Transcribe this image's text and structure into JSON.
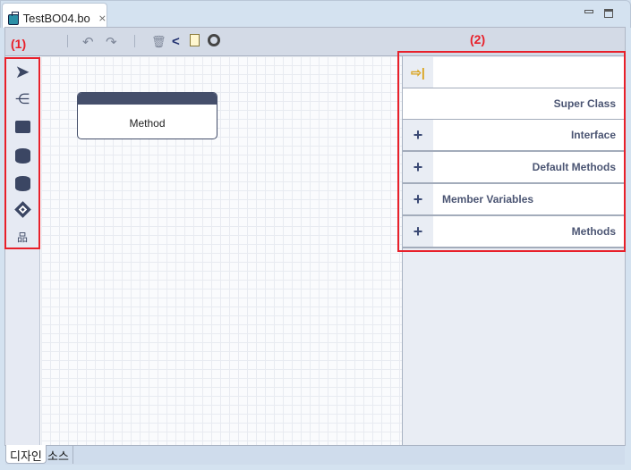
{
  "editor_tab": {
    "title": "TestBO04.bo",
    "icon": "briefcase-icon",
    "close_icon": "close-icon"
  },
  "window_controls": {
    "minimize": "minimize-icon",
    "maximize": "maximize-icon"
  },
  "toolbar": {
    "items": [
      "undo-icon",
      "redo-icon",
      "trash-icon",
      "share-icon",
      "document-icon",
      "refresh-icon"
    ]
  },
  "annotations": {
    "palette_label": "(1)",
    "panel_label": "(2)",
    "color": "#e8202a"
  },
  "palette": {
    "items": [
      "select-arrow-icon",
      "hierarchy-icon",
      "briefcase-icon",
      "database-icon",
      "database-icon",
      "diamond-icon",
      "org-chart-icon"
    ]
  },
  "canvas": {
    "node": {
      "label": "Method",
      "header_color": "#454f6b"
    }
  },
  "panel": {
    "rows": [
      {
        "icon": "arrow-right-icon",
        "label": ""
      },
      {
        "icon": "",
        "label": "Super Class"
      },
      {
        "icon": "+",
        "label": "Interface"
      },
      {
        "icon": "+",
        "label": "Default Methods"
      },
      {
        "icon": "+",
        "label": "Member Variables"
      },
      {
        "icon": "+",
        "label": "Methods"
      }
    ]
  },
  "bottom_tabs": [
    {
      "label": "디자인",
      "active": true
    },
    {
      "label": "소스",
      "active": false
    }
  ]
}
